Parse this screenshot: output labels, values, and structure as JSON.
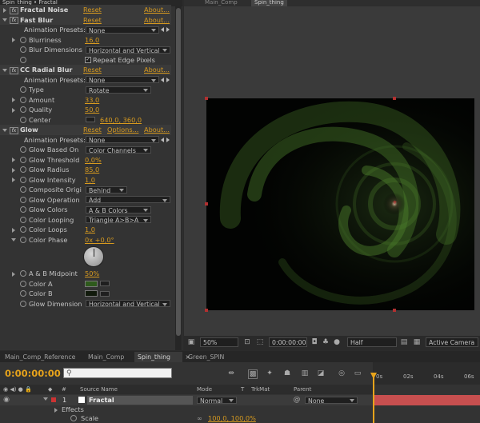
{
  "effect_controls": {
    "title": "Spin_thing • Fractal",
    "effects": [
      {
        "name": "Fractal Noise",
        "reset": "Reset",
        "about": "About..."
      },
      {
        "name": "Fast Blur",
        "reset": "Reset",
        "about": "About...",
        "animation_presets_label": "Animation Presets:",
        "animation_presets_value": "None",
        "params": {
          "blurriness_label": "Blurriness",
          "blurriness_value": "16,0",
          "blur_dimensions_label": "Blur Dimensions",
          "blur_dimensions_value": "Horizontal and Vertical",
          "repeat_edge_label": "Repeat Edge Pixels",
          "repeat_edge_checked": "✓"
        }
      },
      {
        "name": "CC Radial Blur",
        "reset": "Reset",
        "about": "About...",
        "animation_presets_label": "Animation Presets:",
        "animation_presets_value": "None",
        "params": {
          "type_label": "Type",
          "type_value": "Rotate",
          "amount_label": "Amount",
          "amount_value": "33,0",
          "quality_label": "Quality",
          "quality_value": "50,0",
          "center_label": "Center",
          "center_value": "640,0, 360,0"
        }
      },
      {
        "name": "Glow",
        "reset": "Reset",
        "options": "Options...",
        "about": "About...",
        "animation_presets_label": "Animation Presets:",
        "animation_presets_value": "None",
        "params": {
          "based_on_label": "Glow Based On",
          "based_on_value": "Color Channels",
          "threshold_label": "Glow Threshold",
          "threshold_value": "0,0%",
          "radius_label": "Glow Radius",
          "radius_value": "85,0",
          "intensity_label": "Glow Intensity",
          "intensity_value": "1,0",
          "composite_label": "Composite Origi",
          "composite_value": "Behind",
          "operation_label": "Glow Operation",
          "operation_value": "Add",
          "colors_label": "Glow Colors",
          "colors_value": "A & B Colors",
          "looping_label": "Color Looping",
          "looping_value": "Triangle A>B>A",
          "loops_label": "Color Loops",
          "loops_value": "1,0",
          "phase_label": "Color Phase",
          "phase_value": "0x +0,0°",
          "midpoint_label": "A & B Midpoint",
          "midpoint_value": "50%",
          "color_a_label": "Color A",
          "color_a": "#2e5a1c",
          "color_b_label": "Color B",
          "color_b": "#111a0c",
          "dimension_label": "Glow Dimension",
          "dimension_value": "Horizontal and Vertical"
        }
      }
    ]
  },
  "viewer": {
    "tabs": [
      "Main_Comp",
      "Spin_thing"
    ],
    "zoom": "50%",
    "timecode": "0:00:00:00",
    "resolution": "Half",
    "camera": "Active Camera"
  },
  "timeline": {
    "tabs": [
      "Main_Comp_Reference",
      "Main_Comp",
      "Spin_thing",
      "Green_SPIN"
    ],
    "active_tab_close": "×",
    "timecode": "0:00:00:00",
    "columns": {
      "hash": "#",
      "source_name": "Source Name",
      "mode": "Mode",
      "t": "T",
      "trkmat": "TrkMat",
      "parent": "Parent"
    },
    "layer": {
      "index": "1",
      "name": "Fractal",
      "mode": "Normal",
      "parent": "None"
    },
    "sub_rows": {
      "effects": "Effects",
      "scale_label": "Scale",
      "scale_value": "100,0, 100,0%"
    },
    "ruler": [
      "0s",
      "02s",
      "04s",
      "06s"
    ]
  },
  "colors": {
    "accent": "#d79a1f",
    "timecode": "#e7a31b",
    "layer_bar": "#c74f4f",
    "glow_green": "#4a7a2a"
  }
}
